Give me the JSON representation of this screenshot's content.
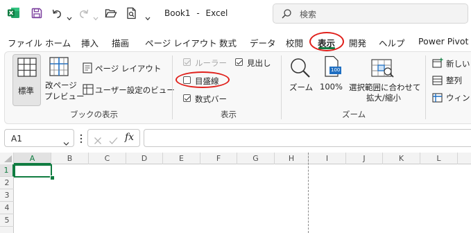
{
  "titlebar": {
    "doc_title": "Book1",
    "separator": "-",
    "app_name": "Excel",
    "search_placeholder": "検索"
  },
  "menu": {
    "items": [
      "ファイル",
      "ホーム",
      "挿入",
      "描画",
      "ページ レイアウト",
      "数式",
      "データ",
      "校閲",
      "表示",
      "開発",
      "ヘルプ",
      "Power Pivot"
    ],
    "active": "表示"
  },
  "ribbon": {
    "book_view": {
      "normal": "標準",
      "page_break_line1": "改ページ",
      "page_break_line2": "プレビュー",
      "page_layout": "ページ レイアウト",
      "custom_views": "ユーザー設定のビュー",
      "group_label": "ブックの表示"
    },
    "show": {
      "ruler": "ルーラー",
      "gridlines": "目盛線",
      "formula_bar": "数式バー",
      "headings": "見出し",
      "group_label": "表示",
      "ruler_checked": true,
      "gridlines_checked": false,
      "formula_bar_checked": true,
      "headings_checked": true
    },
    "zoom": {
      "zoom": "ズーム",
      "hundred": "100%",
      "hundred_badge": "100",
      "fit_line1": "選択範囲に合わせて",
      "fit_line2": "拡大/縮小",
      "group_label": "ズーム"
    },
    "window": {
      "new_window": "新しいウ",
      "arrange": "整列",
      "freeze": "ウィンド"
    }
  },
  "formula_bar": {
    "name_box": "A1",
    "fx": "fx",
    "content": ""
  },
  "grid": {
    "columns": [
      "A",
      "B",
      "C",
      "D",
      "E",
      "F",
      "G",
      "H",
      "I",
      "J",
      "K",
      "L"
    ],
    "rows": [
      "1",
      "2",
      "3",
      "4",
      "5"
    ]
  },
  "colors": {
    "excel_green": "#107c41",
    "save_purple": "#7a3e9d",
    "annotation_red": "#e0201b",
    "accent_blue": "#1f6fc2"
  }
}
